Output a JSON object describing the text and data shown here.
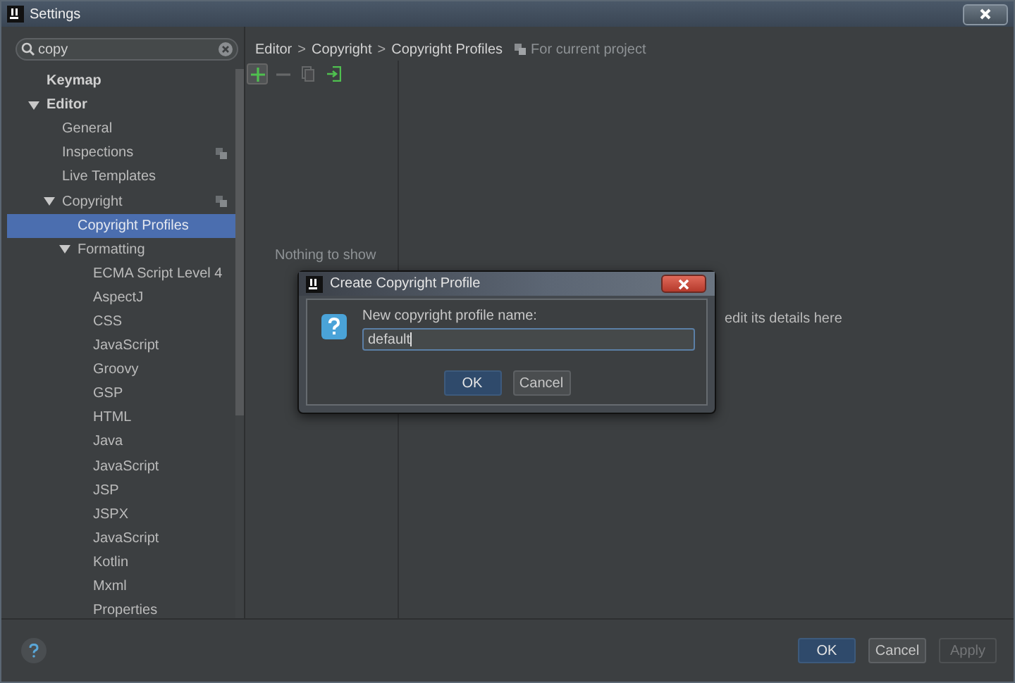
{
  "window": {
    "title": "Settings"
  },
  "search": {
    "value": "copy"
  },
  "tree": [
    {
      "label": "Keymap",
      "bold": true,
      "selected": false,
      "project_scoped": false
    },
    {
      "label": "Editor",
      "bold": true,
      "selected": false,
      "project_scoped": false,
      "expanded": true,
      "children": [
        {
          "label": "General",
          "selected": false,
          "project_scoped": false
        },
        {
          "label": "Inspections",
          "selected": false,
          "project_scoped": true
        },
        {
          "label": "Live Templates",
          "selected": false,
          "project_scoped": false
        },
        {
          "label": "Copyright",
          "selected": false,
          "project_scoped": true,
          "expanded": true,
          "children": [
            {
              "label": "Copyright Profiles",
              "selected": true,
              "project_scoped": false
            },
            {
              "label": "Formatting",
              "selected": false,
              "project_scoped": false,
              "expanded": true,
              "children": [
                {
                  "label": "ECMA Script Level 4",
                  "selected": false,
                  "project_scoped": false
                },
                {
                  "label": "AspectJ",
                  "selected": false,
                  "project_scoped": false
                },
                {
                  "label": "CSS",
                  "selected": false,
                  "project_scoped": false
                },
                {
                  "label": "JavaScript",
                  "selected": false,
                  "project_scoped": false
                },
                {
                  "label": "Groovy",
                  "selected": false,
                  "project_scoped": false
                },
                {
                  "label": "GSP",
                  "selected": false,
                  "project_scoped": false
                },
                {
                  "label": "HTML",
                  "selected": false,
                  "project_scoped": false
                },
                {
                  "label": "Java",
                  "selected": false,
                  "project_scoped": false
                },
                {
                  "label": "JavaScript",
                  "selected": false,
                  "project_scoped": false
                },
                {
                  "label": "JSP",
                  "selected": false,
                  "project_scoped": false
                },
                {
                  "label": "JSPX",
                  "selected": false,
                  "project_scoped": false
                },
                {
                  "label": "JavaScript",
                  "selected": false,
                  "project_scoped": false
                },
                {
                  "label": "Kotlin",
                  "selected": false,
                  "project_scoped": false
                },
                {
                  "label": "Mxml",
                  "selected": false,
                  "project_scoped": false
                },
                {
                  "label": "Properties",
                  "selected": false,
                  "project_scoped": false
                }
              ]
            }
          ]
        }
      ]
    }
  ],
  "breadcrumb": [
    {
      "label": "Editor"
    },
    {
      "separator": ">",
      "label": "Copyright"
    },
    {
      "separator": ">",
      "label": "Copyright Profiles"
    }
  ],
  "scope_note": "For current project",
  "toolbar": [
    {
      "kind": "add",
      "disabled": false
    },
    {
      "kind": "remove",
      "disabled": true
    },
    {
      "kind": "copy",
      "disabled": true
    },
    {
      "kind": "import",
      "disabled": false
    }
  ],
  "profiles_list": {
    "empty_text": "Nothing to show"
  },
  "details_hint": "edit its details here",
  "dialog": {
    "title": "Create Copyright Profile",
    "prompt": "New copyright profile name:",
    "value": "default",
    "buttons": [
      {
        "label": "OK",
        "default": true
      },
      {
        "label": "Cancel",
        "default": false
      }
    ]
  },
  "buttons": [
    {
      "label": "OK",
      "default": true,
      "disabled": false
    },
    {
      "label": "Cancel",
      "default": false,
      "disabled": false
    },
    {
      "label": "Apply",
      "default": false,
      "disabled": true
    }
  ]
}
